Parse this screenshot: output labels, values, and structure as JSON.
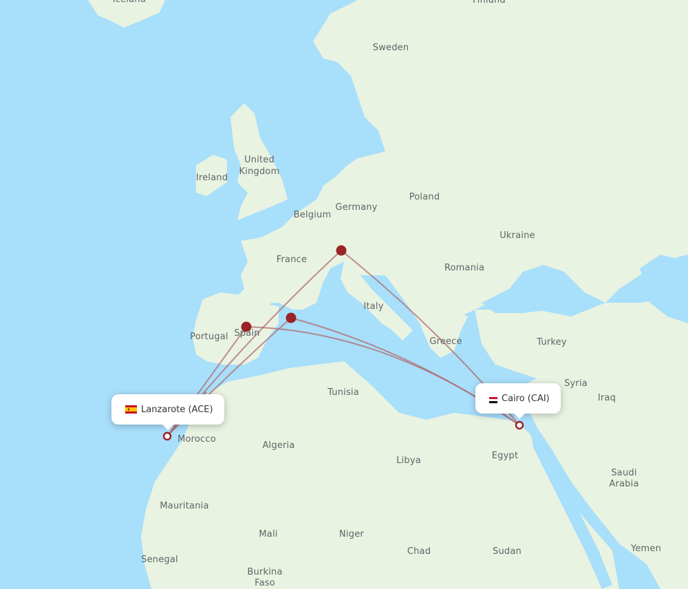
{
  "map": {
    "colors": {
      "water": "#a8dffb",
      "land": "#e9f3e1",
      "border": "#9fd39a",
      "route": "#b06a6e",
      "stop_marker": "#9b2226",
      "label": "#5f6368"
    },
    "origin": {
      "name": "Lanzarote",
      "code": "ACE",
      "label": "Lanzarote (ACE)",
      "flag": "spain-flag"
    },
    "destination": {
      "name": "Cairo",
      "code": "CAI",
      "label": "Cairo (CAI)",
      "flag": "egypt-flag"
    },
    "stopovers": [
      {
        "name": "madrid-stop"
      },
      {
        "name": "barcelona-stop"
      },
      {
        "name": "zurich-stop"
      }
    ],
    "country_labels": [
      "Iceland",
      "Finland",
      "Sweden",
      "United",
      "Kingdom",
      "Ireland",
      "Germany",
      "Poland",
      "Belgium",
      "Ukraine",
      "France",
      "Romania",
      "Italy",
      "Portugal",
      "Spain",
      "Greece",
      "Turkey",
      "Syria",
      "Iraq",
      "Tunisia",
      "Morocco",
      "Algeria",
      "Libya",
      "Egypt",
      "Saudi",
      "Arabia",
      "Mauritania",
      "Mali",
      "Niger",
      "Chad",
      "Sudan",
      "Senegal",
      "Burkina",
      "Faso",
      "Yemen"
    ]
  }
}
